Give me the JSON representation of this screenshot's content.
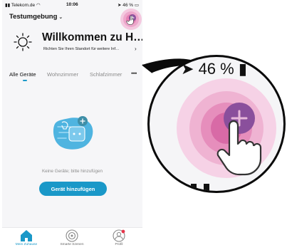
{
  "status_bar": {
    "carrier": "Telekom.de",
    "time": "10:06",
    "battery": "46 %"
  },
  "header": {
    "home_name": "Testumgebung"
  },
  "welcome": {
    "title": "Willkommen zu H…",
    "subtitle": "Richten Sie Ihren Standort für weitere Inf…"
  },
  "tabs": [
    {
      "label": "Alle Geräte"
    },
    {
      "label": "Wohnzimmer"
    },
    {
      "label": "Schlafzimmer"
    }
  ],
  "tab_more": "•••",
  "empty_state": {
    "text": "Keine Geräte; bitte hinzufügen",
    "button_label": "Gerät hinzufügen"
  },
  "bottom_nav": [
    {
      "label": "Mein Zuhause",
      "icon": "home-icon"
    },
    {
      "label": "Smarte Szenen",
      "icon": "scenes-icon"
    },
    {
      "label": "Profil",
      "icon": "profile-icon"
    }
  ],
  "zoom": {
    "status_text": "46 %"
  },
  "colors": {
    "accent": "#1a98c8",
    "pulse_pink": "#e26aa8",
    "plus_button": "#8a4f9c",
    "illustration": "#4fb4e0"
  }
}
